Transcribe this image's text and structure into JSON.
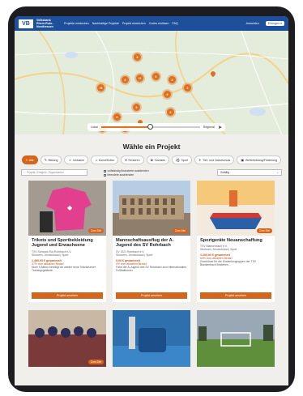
{
  "header": {
    "brand": "Volksbank Rhein-Ruhr-Nordhessen",
    "brand_short": "VB",
    "nav": [
      "Projekte entdecken",
      "Nachhaltige Projekte",
      "Projekt einreichen",
      "Codes einlösen",
      "FAQ"
    ],
    "login": "Anmelden",
    "region": "Ehringen ▾"
  },
  "map": {
    "clusters": [
      "8",
      "8",
      "12",
      "75",
      "6",
      "8",
      "6",
      "3",
      "9",
      "6",
      "6",
      "8",
      "4"
    ],
    "radius_left": "Lokal",
    "radius_right": "Regional",
    "radius_level": 0.5
  },
  "main": {
    "heading": "Wähle ein Projekt",
    "categories": [
      {
        "label": "Alle",
        "icon": "≡",
        "active": true
      },
      {
        "label": "Bildung",
        "icon": "✎",
        "active": false
      },
      {
        "label": "Inklusion",
        "icon": "☺",
        "active": false
      },
      {
        "label": "Kunst/Kultur",
        "icon": "♫",
        "active": false
      },
      {
        "label": "Senioren",
        "icon": "♥",
        "active": false
      },
      {
        "label": "Soziales",
        "icon": "✿",
        "active": false
      },
      {
        "label": "Sport",
        "icon": "⚽",
        "active": false
      },
      {
        "label": "Tier- und Naturschutz",
        "icon": "✦",
        "active": false
      },
      {
        "label": "Weiterbildung/Förderung",
        "icon": "▣",
        "active": false
      }
    ],
    "search_placeholder": "Projekt, Ereignis, Organisation",
    "check1": "vollständig finanzierte ausblenden",
    "check2": "beendete ausblenden",
    "sort": "Zufällig"
  },
  "projects": [
    {
      "title": "Trikots und Sportbekleidung Jugend und Erwachsene",
      "org": "TSV Schwarz-Rot Rohrbach e.V.",
      "place": "Strohnen, Deutschland | Sport",
      "amount": "1.490,00 € gesammelt",
      "progress": "37% vom aktuellen Bedarf",
      "desc": "Noch 9 Aktion benötigt wir wieder neue Trikots/unser Trainingsgelände",
      "badge": "Zum Ziel",
      "button": "Projekt ansehen"
    },
    {
      "title": "Mannschaftsausflug der A-Jugend des SV Rohrbach",
      "org": "SV 1921 Rohrbach e.V.",
      "place": "Strohnen, Deutschland | Sport",
      "amount": "0,00 € gesammelt",
      "progress": "0% vom aktuellen Bedarf",
      "desc": "Fahrt der A-Jugend des SV Rohrbach zum internationalen Fußballturnier",
      "badge": "Zum Ziel",
      "button": "Projekt ansehen"
    },
    {
      "title": "Sportgeräte Neuanschaffung",
      "org": "TSV Blankenbach e.V.",
      "place": "Strohnen, Deutschland | Sport",
      "amount": "1.200,00 € gesammelt",
      "progress": "60% vom aktuellen Bedarf",
      "desc": "Zuschüsse für die Kinderturngruppen der TSV Blankenbach Bestehen...",
      "badge": "Zum Ziel",
      "button": "Projekt ansehen"
    }
  ],
  "row2_badges": [
    "Zum Ziel",
    "",
    ""
  ]
}
